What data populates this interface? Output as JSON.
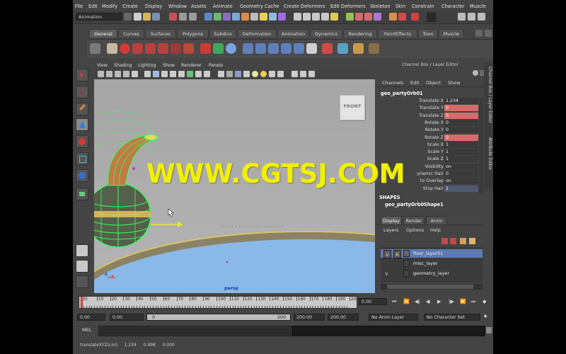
{
  "menu": [
    "File",
    "Edit",
    "Modify",
    "Create",
    "Display",
    "Window",
    "Assets",
    "Animate",
    "Geometry Cache",
    "Create Deformers",
    "Edit Deformers",
    "Skeleton",
    "Skin",
    "Constrain",
    "Character",
    "Muscle"
  ],
  "mode_selector": "Animation",
  "shelf_tabs": [
    "General",
    "Curves",
    "Surfaces",
    "Polygons",
    "Subdivs",
    "Deformation",
    "Animation",
    "Dynamics",
    "Rendering",
    "PaintEffects",
    "Toon",
    "Muscle"
  ],
  "active_shelf_tab": "General",
  "viewport": {
    "menu": [
      "View",
      "Shading",
      "Lighting",
      "Show",
      "Renderer",
      "Panels"
    ],
    "camera_label": "persp",
    "view_cube": "FRONT",
    "axis_x": "x",
    "axis_z": "z"
  },
  "channel_box": {
    "header": "Channel Box / Layer Editor",
    "menu": [
      "Channels",
      "Edit",
      "Object",
      "Show"
    ],
    "object_name": "geo_partyOrb01",
    "channels": [
      {
        "label": "Translate X",
        "value": "1.234",
        "style": "normal"
      },
      {
        "label": "Translate Y",
        "value": "0",
        "style": "red"
      },
      {
        "label": "Translate Z",
        "value": "0",
        "style": "red"
      },
      {
        "label": "Rotate X",
        "value": "0",
        "style": "normal"
      },
      {
        "label": "Rotate Y",
        "value": "0",
        "style": "normal"
      },
      {
        "label": "Rotate Z",
        "value": "0",
        "style": "red"
      },
      {
        "label": "Scale X",
        "value": "1",
        "style": "normal"
      },
      {
        "label": "Scale Y",
        "value": "1",
        "style": "normal"
      },
      {
        "label": "Scale Z",
        "value": "1",
        "style": "normal"
      },
      {
        "label": "Visibility",
        "value": "on",
        "style": "normal"
      },
      {
        "label": "ynamic Hair",
        "value": "0",
        "style": "normal"
      },
      {
        "label": "to Overlap",
        "value": "on",
        "style": "normal"
      },
      {
        "label": "Stop Hair",
        "value": "1",
        "style": "blue"
      }
    ],
    "shapes_label": "SHAPES",
    "shape_name": "geo_partyOrb0Shape1"
  },
  "side_tabs": [
    "Channel Box / Layer Editor",
    "Attribute Editor"
  ],
  "layer_editor": {
    "tabs": [
      "Display",
      "Render",
      "Anim"
    ],
    "active_tab": "Display",
    "menu": [
      "Layers",
      "Options",
      "Help"
    ],
    "layers": [
      {
        "v": "V",
        "r": "R",
        "name": "floor_layer01",
        "selected": true
      },
      {
        "v": "",
        "r": "",
        "name": "misc_layer",
        "selected": false
      },
      {
        "v": "V",
        "r": "",
        "name": "geometry_layer",
        "selected": false
      }
    ]
  },
  "time_slider": {
    "ticks": [
      "0",
      "10",
      "20",
      "30",
      "40",
      "50",
      "60",
      "70",
      "80",
      "90",
      "100",
      "110",
      "120",
      "130",
      "140",
      "150",
      "160",
      "170",
      "180",
      "190",
      "200"
    ],
    "current_time": "0.00"
  },
  "range_slider": {
    "start_field": "0.00",
    "start_inner": "0.00",
    "range_start": "0",
    "range_end": "200",
    "end_inner": "200.00",
    "end_field": "200.00",
    "anim_layer": "No Anim Layer",
    "character_set": "No Character Set"
  },
  "command_line": {
    "label": "MEL",
    "value": ""
  },
  "help_line": {
    "label": "translateXYZ(cm):",
    "values": [
      "1.234",
      "0.998",
      "0.000"
    ]
  },
  "watermark": "WWW.CGTSJ.COM",
  "colors": {
    "accent_select": "#5d7ab2",
    "keyed_red": "#d96a6a",
    "watermark": "#f0f000",
    "floor_blue": "#8ab8e8"
  }
}
